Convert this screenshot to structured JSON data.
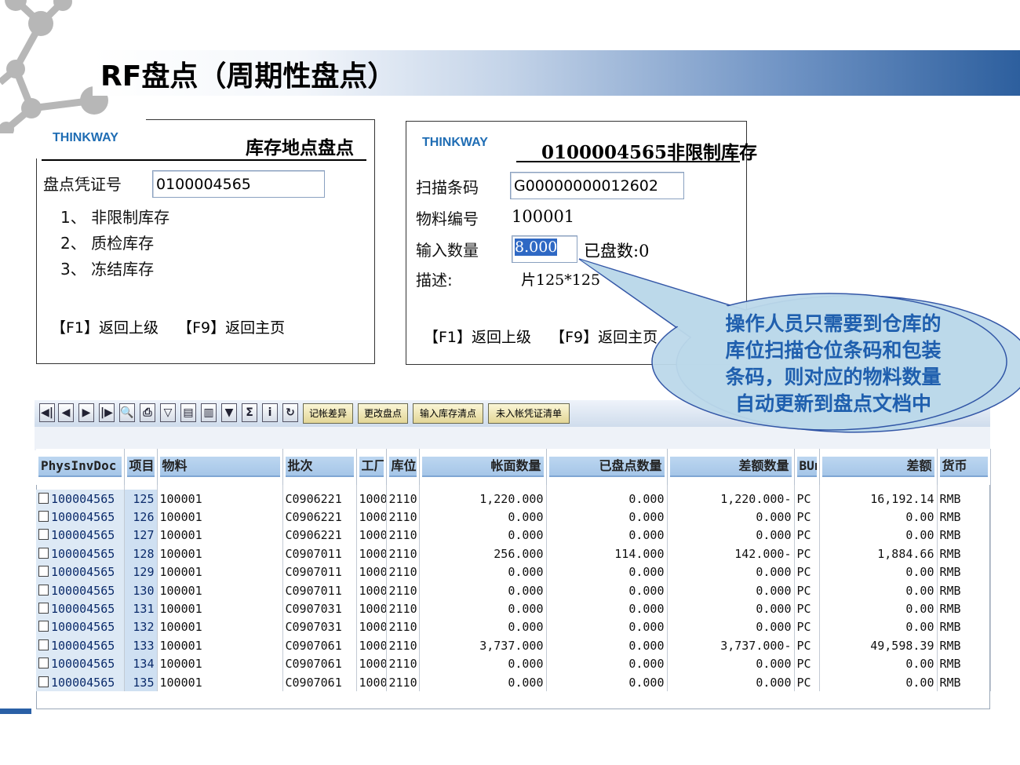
{
  "title": "RF盘点（周期性盘点）",
  "screen1": {
    "brand": "THINKWAY",
    "heading": "库存地点盘点",
    "doc_label": "盘点凭证号",
    "doc_value": "0100004565",
    "options": [
      "1、 非限制库存",
      "2、 质检库存",
      "3、 冻结库存"
    ],
    "f1": "【F1】返回上级",
    "f9": "【F9】返回主页"
  },
  "screen2": {
    "brand": "THINKWAY",
    "heading": "0100004565非限制库存",
    "scan_label": "扫描条码",
    "scan_value": "G00000000012602",
    "material_label": "物料编号",
    "material_value": "100001",
    "qty_label": "输入数量",
    "qty_value": "8.000",
    "counted": "已盘数:0",
    "desc_label": "描述:",
    "desc_value": "片125*125",
    "f1": "【F1】返回上级",
    "f9": "【F9】返回主页"
  },
  "callout": [
    "操作人员只需要到仓库的",
    "库位扫描仓位条码和包装",
    "条码，则对应的物料数量",
    "自动更新到盘点文档中"
  ],
  "toolbar": {
    "icons": [
      "first-page-icon",
      "prev-page-icon",
      "next-page-icon",
      "last-page-icon",
      "find-icon",
      "print-icon",
      "filter-icon",
      "layout-icon",
      "export-icon",
      "sort-icon",
      "sum-icon",
      "info-icon",
      "refresh-icon"
    ],
    "buttons": [
      "记帐差异",
      "更改盘点",
      "输入库存清点",
      "未入帐凭证清单"
    ]
  },
  "table": {
    "headers": [
      "PhysInvDoc",
      "项目",
      "物料",
      "批次",
      "工厂",
      "库位",
      "帐面数量",
      "已盘点数量",
      "差额数量",
      "BUn",
      "差额",
      "货币"
    ],
    "rows": [
      [
        "100004565",
        "125",
        "100001",
        "C0906221",
        "1000",
        "2110",
        "1,220.000",
        "0.000",
        "1,220.000-",
        "PC",
        "16,192.14",
        "RMB"
      ],
      [
        "100004565",
        "126",
        "100001",
        "C0906221",
        "1000",
        "2110",
        "0.000",
        "0.000",
        "0.000",
        "PC",
        "0.00",
        "RMB"
      ],
      [
        "100004565",
        "127",
        "100001",
        "C0906221",
        "1000",
        "2110",
        "0.000",
        "0.000",
        "0.000",
        "PC",
        "0.00",
        "RMB"
      ],
      [
        "100004565",
        "128",
        "100001",
        "C0907011",
        "1000",
        "2110",
        "256.000",
        "114.000",
        "142.000-",
        "PC",
        "1,884.66",
        "RMB"
      ],
      [
        "100004565",
        "129",
        "100001",
        "C0907011",
        "1000",
        "2110",
        "0.000",
        "0.000",
        "0.000",
        "PC",
        "0.00",
        "RMB"
      ],
      [
        "100004565",
        "130",
        "100001",
        "C0907011",
        "1000",
        "2110",
        "0.000",
        "0.000",
        "0.000",
        "PC",
        "0.00",
        "RMB"
      ],
      [
        "100004565",
        "131",
        "100001",
        "C0907031",
        "1000",
        "2110",
        "0.000",
        "0.000",
        "0.000",
        "PC",
        "0.00",
        "RMB"
      ],
      [
        "100004565",
        "132",
        "100001",
        "C0907031",
        "1000",
        "2110",
        "0.000",
        "0.000",
        "0.000",
        "PC",
        "0.00",
        "RMB"
      ],
      [
        "100004565",
        "133",
        "100001",
        "C0907061",
        "1000",
        "2110",
        "3,737.000",
        "0.000",
        "3,737.000-",
        "PC",
        "49,598.39",
        "RMB"
      ],
      [
        "100004565",
        "134",
        "100001",
        "C0907061",
        "1000",
        "2110",
        "0.000",
        "0.000",
        "0.000",
        "PC",
        "0.00",
        "RMB"
      ],
      [
        "100004565",
        "135",
        "100001",
        "C0907061",
        "1000",
        "2110",
        "0.000",
        "0.000",
        "0.000",
        "PC",
        "0.00",
        "RMB"
      ]
    ]
  }
}
